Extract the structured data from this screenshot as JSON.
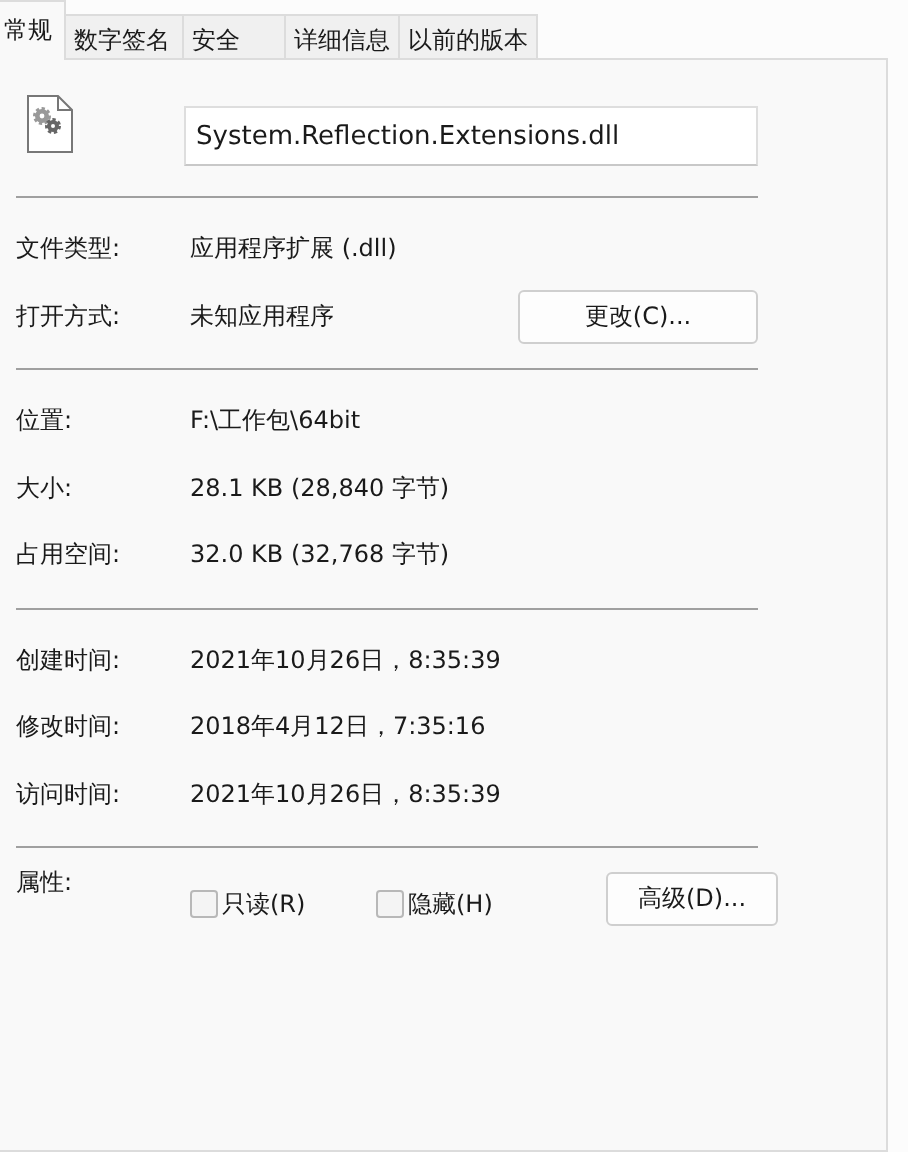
{
  "tabs": [
    {
      "label": "常规",
      "selected": true
    },
    {
      "label": "数字签名",
      "selected": false
    },
    {
      "label": "安全",
      "selected": false
    },
    {
      "label": "详细信息",
      "selected": false
    },
    {
      "label": "以前的版本",
      "selected": false
    }
  ],
  "file_name": "System.Reflection.Extensions.dll",
  "sections": [
    [
      {
        "label": "文件类型:",
        "value": "应用程序扩展 (.dll)"
      },
      {
        "label": "打开方式:",
        "value": "未知应用程序",
        "button": "更改(C)..."
      }
    ],
    [
      {
        "label": "位置:",
        "value": "F:\\工作包\\64bit"
      },
      {
        "label": "大小:",
        "value": "28.1 KB (28,840 字节)"
      },
      {
        "label": "占用空间:",
        "value": "32.0 KB (32,768 字节)"
      }
    ],
    [
      {
        "label": "创建时间:",
        "value": "2021年10月26日，8:35:39"
      },
      {
        "label": "修改时间:",
        "value": "2018年4月12日，7:35:16"
      },
      {
        "label": "访问时间:",
        "value": "2021年10月26日，8:35:39"
      }
    ]
  ],
  "attributes": {
    "label": "属性:",
    "checkboxes": [
      {
        "label": "只读(R)",
        "checked": false
      },
      {
        "label": "隐藏(H)",
        "checked": false
      }
    ],
    "button": "高级(D)..."
  }
}
